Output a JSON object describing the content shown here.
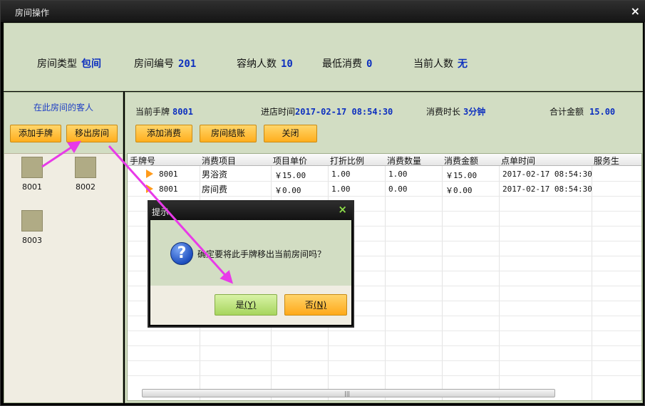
{
  "window": {
    "title": "房间操作",
    "close_glyph": "×"
  },
  "room_info": {
    "type_label": "房间类型",
    "type_value": "包间",
    "number_label": "房间编号",
    "number_value": "201",
    "capacity_label": "容纳人数",
    "capacity_value": "10",
    "min_spend_label": "最低消费",
    "min_spend_value": "0",
    "current_people_label": "当前人数",
    "current_people_value": "无"
  },
  "guests_panel": {
    "title": "在此房间的客人",
    "add_tag_button": "添加手牌",
    "remove_from_room_button": "移出房间",
    "guests": [
      {
        "tag": "8001"
      },
      {
        "tag": "8002"
      },
      {
        "tag": "8003"
      }
    ]
  },
  "session": {
    "current_tag_label": "当前手牌",
    "current_tag_value": "8001",
    "checkin_label": "进店时间",
    "checkin_value": "2017-02-17 08:54:30",
    "duration_label": "消费时长",
    "duration_value": "3分钟",
    "total_label": "合计金额",
    "total_value": "15.00"
  },
  "actions": {
    "add_consumption": "添加消费",
    "checkout": "房间结账",
    "close": "关闭"
  },
  "table": {
    "columns": [
      "手牌号",
      "消费项目",
      "项目单价",
      "打折比例",
      "消费数量",
      "消费金额",
      "点单时间",
      "服务生"
    ],
    "rows": [
      {
        "tag": "8001",
        "item": "男浴资",
        "price": "￥15.00",
        "discount": "1.00",
        "qty": "1.00",
        "amount": "￥15.00",
        "time": "2017-02-17 08:54:30",
        "waiter": ""
      },
      {
        "tag": "8001",
        "item": "房间费",
        "price": "￥0.00",
        "discount": "1.00",
        "qty": "0.00",
        "amount": "￥0.00",
        "time": "2017-02-17 08:54:30",
        "waiter": ""
      }
    ],
    "scroll_grip": "|||"
  },
  "dialog": {
    "title": "提示",
    "close_glyph": "×",
    "icon": "question-icon",
    "icon_glyph": "?",
    "message": "确定要将此手牌移出当前房间吗？",
    "yes_text": "是",
    "yes_key": "(Y)",
    "no_text": "否",
    "no_key": "(N)"
  },
  "colors": {
    "panel_green": "#d2ddc3",
    "value_blue": "#0c2fbf",
    "button_orange": "#ffae1d",
    "annotation_magenta": "#e83ae8"
  }
}
